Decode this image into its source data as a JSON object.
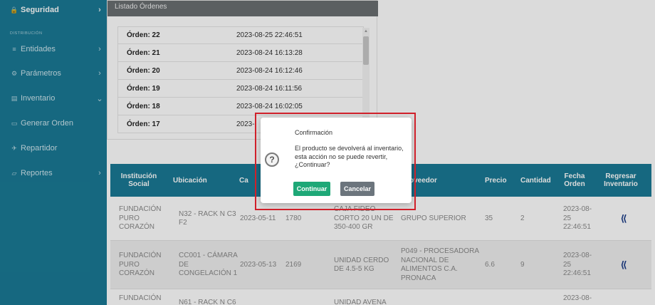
{
  "sidebar": {
    "section_label": "DISTRIBUCIÓN",
    "items": [
      {
        "icon": "lock-icon",
        "glyph": "🔒",
        "label": "Seguridad",
        "chevron": "›"
      },
      {
        "icon": "list-icon",
        "glyph": "≡",
        "label": "Entidades",
        "chevron": "›"
      },
      {
        "icon": "settings-icon",
        "glyph": "⚙",
        "label": "Parámetros",
        "chevron": "›"
      },
      {
        "icon": "inventory-icon",
        "glyph": "▤",
        "label": "Inventario",
        "chevron": "⌄"
      },
      {
        "icon": "order-icon",
        "glyph": "▭",
        "label": "Generar Orden",
        "chevron": ""
      },
      {
        "icon": "delivery-icon",
        "glyph": "✈",
        "label": "Repartidor",
        "chevron": ""
      },
      {
        "icon": "reports-icon",
        "glyph": "▱",
        "label": "Reportes",
        "chevron": "›"
      }
    ]
  },
  "orders": {
    "header": "Listado Órdenes",
    "rows": [
      {
        "label": "Órden: 22",
        "date": "2023-08-25 22:46:51"
      },
      {
        "label": "Órden: 21",
        "date": "2023-08-24 16:13:28"
      },
      {
        "label": "Órden: 20",
        "date": "2023-08-24 16:12:46"
      },
      {
        "label": "Órden: 19",
        "date": "2023-08-24 16:11:56"
      },
      {
        "label": "Órden: 18",
        "date": "2023-08-24 16:02:05"
      },
      {
        "label": "Órden: 17",
        "date": "2023-"
      }
    ]
  },
  "table": {
    "headers": [
      "Institución Social",
      "Ubicación",
      "Ca",
      "",
      "",
      "oveedor",
      "Precio",
      "Cantidad",
      "Fecha Orden",
      "Regresar Inventario"
    ],
    "rows": [
      {
        "institucion": "FUNDACIÓN PURO CORAZÓN",
        "ubicacion": "N32 - RACK N C3 F2",
        "caducidad": "2023-05-11",
        "codigo": "1780",
        "producto": "CAJA FIDEO CORTO 20 UN DE 350-400 GR",
        "proveedor": "GRUPO SUPERIOR",
        "precio": "35",
        "cantidad": "2",
        "fecha": "2023-08-25 22:46:51"
      },
      {
        "institucion": "FUNDACIÓN PURO CORAZÓN",
        "ubicacion": "CC001 - CÁMARA DE CONGELACIÓN 1",
        "caducidad": "2023-05-13",
        "codigo": "2169",
        "producto": "UNIDAD CERDO DE 4.5-5 KG",
        "proveedor": "P049 - PROCESADORA NACIONAL DE ALIMENTOS C.A. PRONACA",
        "precio": "6.6",
        "cantidad": "9",
        "fecha": "2023-08-25 22:46:51"
      },
      {
        "institucion": "FUNDACIÓN",
        "ubicacion": "N61 - RACK N C6",
        "caducidad": "",
        "codigo": "",
        "producto": "UNIDAD AVENA",
        "proveedor": "",
        "precio": "",
        "cantidad": "",
        "fecha": "2023-08-"
      }
    ]
  },
  "modal": {
    "title": "Confirmación",
    "icon": "?",
    "message": "El producto se devolverá al inventario, esta acción no se puede revertir, ¿Continuar?",
    "confirm_label": "Continuar",
    "cancel_label": "Cancelar"
  },
  "colors": {
    "sidebar": "#1a7a95",
    "table_header": "#1a7a95",
    "continue_button": "#1ea877",
    "cancel_button": "#6c757d",
    "highlight": "#d0202a"
  }
}
